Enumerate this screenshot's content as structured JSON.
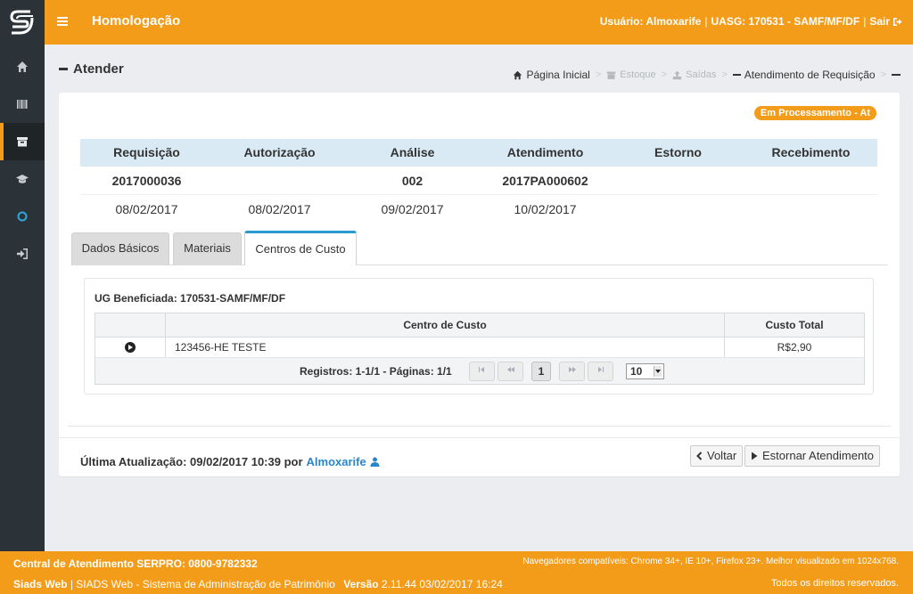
{
  "app": {
    "title": "Homologação"
  },
  "topbar": {
    "user_label": "Usuário: Almoxarife",
    "uasg_label": "UASG: 170531 - SAMF/MF/DF",
    "logout_label": "Sair",
    "separator": "|"
  },
  "sidebar": {
    "items": [
      {
        "name": "home",
        "icon": "home-icon"
      },
      {
        "name": "barcode",
        "icon": "barcode-icon"
      },
      {
        "name": "archive",
        "icon": "archive-icon",
        "active": true
      },
      {
        "name": "graduation",
        "icon": "graduation-cap-icon"
      },
      {
        "name": "circle",
        "icon": "circle-icon"
      },
      {
        "name": "sign-in",
        "icon": "sign-in-icon"
      }
    ]
  },
  "page": {
    "title": "Atender"
  },
  "breadcrumb": {
    "home": "Página Inicial",
    "estoque": "Estoque",
    "saidas": "Saídas",
    "current": "Atendimento de Requisição"
  },
  "status_badge": "Em Processamento - At",
  "summary": {
    "headers": [
      "Requisição",
      "Autorização",
      "Análise",
      "Atendimento",
      "Estorno",
      "Recebimento"
    ],
    "numbers": [
      "2017000036",
      "",
      "002",
      "2017PA000602",
      "",
      ""
    ],
    "dates": [
      "08/02/2017",
      "08/02/2017",
      "09/02/2017",
      "10/02/2017",
      "",
      ""
    ]
  },
  "tabs": [
    {
      "label": "Dados Básicos"
    },
    {
      "label": "Materiais"
    },
    {
      "label": "Centros de Custo",
      "active": true
    }
  ],
  "centros": {
    "ug_label": "UG Beneficiada: 170531-SAMF/MF/DF",
    "columns": [
      "",
      "Centro de Custo",
      "Custo Total"
    ],
    "rows": [
      {
        "centro": "123456-HE TESTE",
        "custo": "R$2,90"
      }
    ],
    "pager": {
      "text": "Registros: 1-1/1 - Páginas: 1/1",
      "current_page": "1",
      "page_size": "10"
    }
  },
  "footer": {
    "last_update_label": "Última Atualização: 09/02/2017 10:39 por",
    "user": "Almoxarife",
    "back_label": "Voltar",
    "estornar_label": "Estornar Atendimento"
  },
  "bottom": {
    "central": "Central de Atendimento SERPRO: 0800-9782332",
    "browsers": "Navegadores compatíveis: Chrome 34+, IE 10+, Firefox 23+. Melhor visualizado em 1024x768.",
    "siads_bold": "Siads Web",
    "siads_rest": "| SIADS Web - Sistema de Administração de Patrimônio",
    "version_label": "Versão",
    "version_value": "2.11.44 03/02/2017 16:24",
    "rights": "Todos os direitos reservados."
  },
  "colors": {
    "accent": "#f39c1a",
    "sidebar": "#2c3338",
    "link": "#2a86c9",
    "tab_active": "#2a9bd1",
    "summary_head": "#daeaf4"
  }
}
